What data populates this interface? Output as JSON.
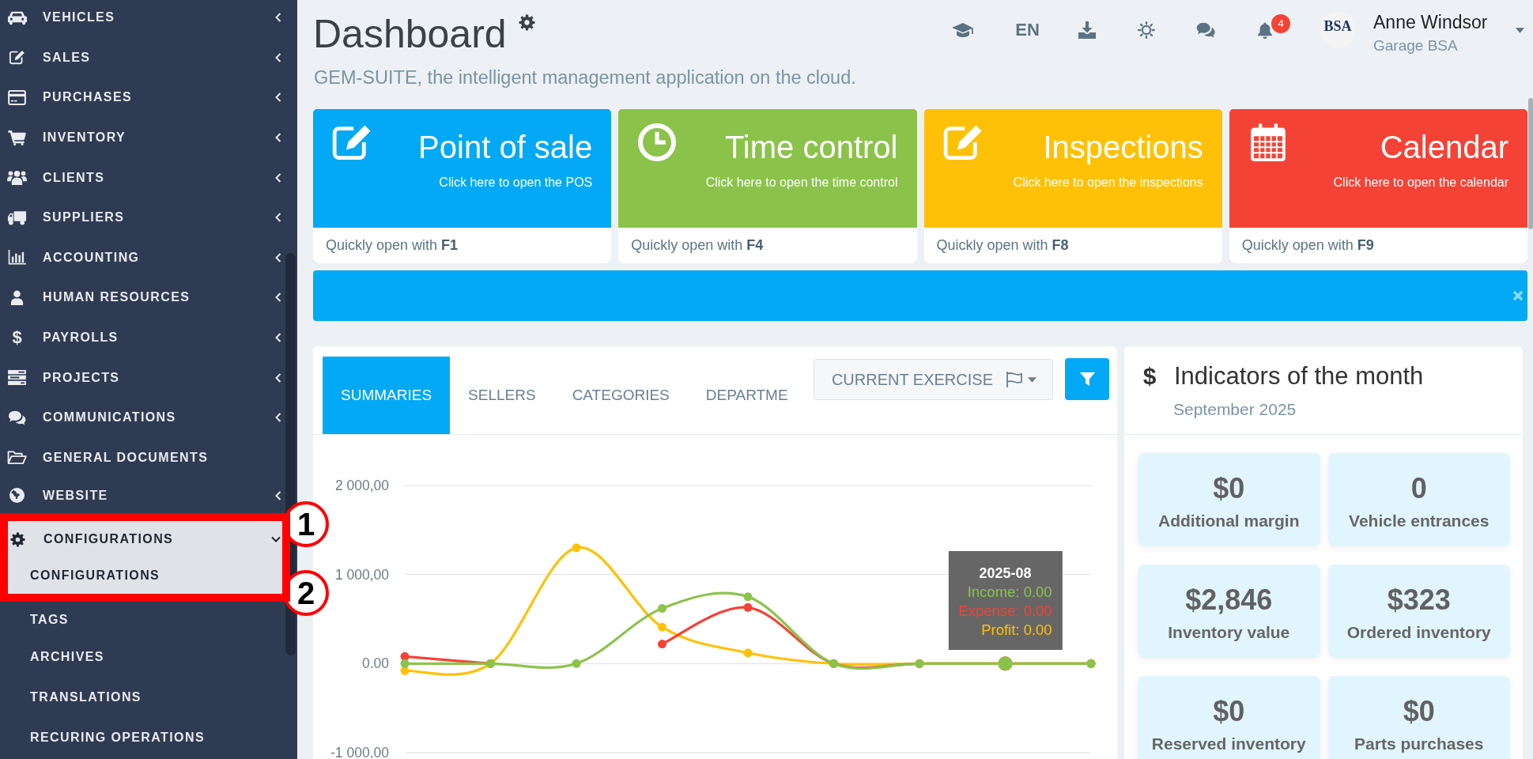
{
  "sidebar": {
    "items": [
      {
        "label": "VEHICLES",
        "submenu": true,
        "expanded": false,
        "selected": false
      },
      {
        "label": "SALES",
        "submenu": true,
        "expanded": false,
        "selected": false
      },
      {
        "label": "PURCHASES",
        "submenu": true,
        "expanded": false,
        "selected": false
      },
      {
        "label": "INVENTORY",
        "submenu": true,
        "expanded": false,
        "selected": false
      },
      {
        "label": "CLIENTS",
        "submenu": true,
        "expanded": false,
        "selected": false
      },
      {
        "label": "SUPPLIERS",
        "submenu": true,
        "expanded": false,
        "selected": false
      },
      {
        "label": "ACCOUNTING",
        "submenu": true,
        "expanded": false,
        "selected": false
      },
      {
        "label": "HUMAN RESOURCES",
        "submenu": true,
        "expanded": false,
        "selected": false
      },
      {
        "label": "PAYROLLS",
        "icon_char": "$",
        "submenu": true,
        "expanded": false,
        "selected": false
      },
      {
        "label": "PROJECTS",
        "submenu": true,
        "expanded": false,
        "selected": false
      },
      {
        "label": "COMMUNICATIONS",
        "submenu": true,
        "expanded": false,
        "selected": false
      },
      {
        "label": "GENERAL DOCUMENTS",
        "submenu": false,
        "expanded": false,
        "selected": false
      },
      {
        "label": "WEBSITE",
        "submenu": true,
        "expanded": false,
        "selected": false
      },
      {
        "label": "CONFIGURATIONS",
        "submenu": true,
        "expanded": true,
        "selected": true,
        "children": [
          {
            "label": "CONFIGURATIONS",
            "selected": true
          },
          {
            "label": "TAGS",
            "selected": false
          },
          {
            "label": "ARCHIVES",
            "selected": false
          },
          {
            "label": "TRANSLATIONS",
            "selected": false
          },
          {
            "label": "RECURING OPERATIONS",
            "selected": false
          }
        ]
      }
    ]
  },
  "header": {
    "title": "Dashboard",
    "subtitle": "GEM-SUITE, the intelligent management application on the cloud.",
    "language": "EN",
    "notifications": "4",
    "user": {
      "logo_text": "BSA",
      "name": "Anne Windsor",
      "company": "Garage BSA"
    }
  },
  "shortcuts": [
    {
      "title": "Point of sale",
      "subtitle": "Click here to open the POS",
      "hint": "Quickly open with **F1**",
      "color": "#03a9f4"
    },
    {
      "title": "Time control",
      "subtitle": "Click here to open the time control",
      "hint": "Quickly open with **F4**",
      "color": "#8bc34a"
    },
    {
      "title": "Inspections",
      "subtitle": "Click here to open the inspections",
      "hint": "Quickly open with **F8**",
      "color": "#ffc107"
    },
    {
      "title": "Calendar",
      "subtitle": "Click here to open the calendar",
      "hint": "Quickly open with **F9**",
      "color": "#f44336"
    }
  ],
  "banner": {
    "closable": true
  },
  "summary": {
    "tabs": [
      {
        "label": "SUMMARIES",
        "selected": true
      },
      {
        "label": "SELLERS",
        "selected": false
      },
      {
        "label": "CATEGORIES",
        "selected": false
      },
      {
        "label": "DEPARTME",
        "selected": false
      }
    ],
    "period_button": "CURRENT EXERCISE",
    "chart_data": {
      "type": "line",
      "grid": true,
      "ylim": [
        -1000,
        2000
      ],
      "yticks": [
        {
          "value": 2000,
          "label": "2 000,00"
        },
        {
          "value": 1000,
          "label": "1 000,00"
        },
        {
          "value": 0,
          "label": "0.00"
        },
        {
          "value": -1000,
          "label": "-1 000,00"
        }
      ],
      "series": [
        {
          "color": "#8bc34a",
          "marker": true,
          "values": [
            0,
            0,
            0,
            620,
            750,
            0,
            0,
            0,
            0
          ]
        },
        {
          "color": "#f44336",
          "marker": true,
          "values": [
            80,
            0,
            null,
            220,
            630,
            0,
            0,
            0,
            0
          ]
        },
        {
          "color": "#ffc107",
          "marker": true,
          "values": [
            -80,
            0,
            1300,
            410,
            120,
            0,
            0,
            0,
            0
          ]
        }
      ]
    },
    "tooltip": {
      "title": "2025-08",
      "hovered": [
        false,
        false,
        false,
        false,
        false,
        false,
        false,
        true,
        false
      ],
      "lines": [
        {
          "text": "Income: 0.00",
          "color": "#8bc34a"
        },
        {
          "text": "Expense: 0.00",
          "color": "#f44336"
        },
        {
          "text": "Profit: 0.00",
          "color": "#ffc107"
        }
      ]
    }
  },
  "indicators": {
    "icon_char": "$",
    "title": "Indicators of the month",
    "period": "September 2025",
    "stats": [
      {
        "value": "$0",
        "label": "Additional margin"
      },
      {
        "value": "0",
        "label": "Vehicle entrances"
      },
      {
        "value": "$2,846",
        "label": "Inventory value"
      },
      {
        "value": "$323",
        "label": "Ordered inventory"
      },
      {
        "value": "$0",
        "label": "Reserved inventory"
      },
      {
        "value": "$0",
        "label": "Parts purchases"
      }
    ]
  },
  "annotations": {
    "frame": true,
    "markers": [
      {
        "label": "1"
      },
      {
        "label": "2"
      }
    ]
  }
}
